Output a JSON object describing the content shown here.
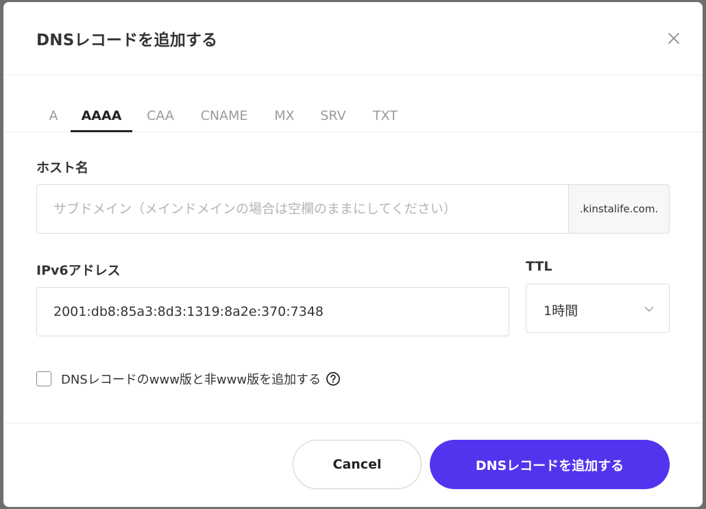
{
  "dialog": {
    "title": "DNSレコードを追加する",
    "close_icon": "close-icon"
  },
  "tabs": [
    {
      "label": "A",
      "active": false
    },
    {
      "label": "AAAA",
      "active": true
    },
    {
      "label": "CAA",
      "active": false
    },
    {
      "label": "CNAME",
      "active": false
    },
    {
      "label": "MX",
      "active": false
    },
    {
      "label": "SRV",
      "active": false
    },
    {
      "label": "TXT",
      "active": false
    }
  ],
  "hostname": {
    "label": "ホスト名",
    "placeholder": "サブドメイン（メインドメインの場合は空欄のままにしてください）",
    "value": "",
    "suffix": ".kinstalife.com."
  },
  "ipv6": {
    "label": "IPv6アドレス",
    "value": "2001:db8:85a3:8d3:1319:8a2e:370:7348"
  },
  "ttl": {
    "label": "TTL",
    "selected": "1時間"
  },
  "www_option": {
    "label": "DNSレコードのwww版と非www版を追加する",
    "checked": false,
    "help_icon": "question-circle-icon"
  },
  "footer": {
    "cancel_label": "Cancel",
    "submit_label": "DNSレコードを追加する"
  },
  "colors": {
    "primary": "#5333ed",
    "text": "#333333",
    "muted": "#9a9a9a",
    "border": "#dcdcdc"
  }
}
